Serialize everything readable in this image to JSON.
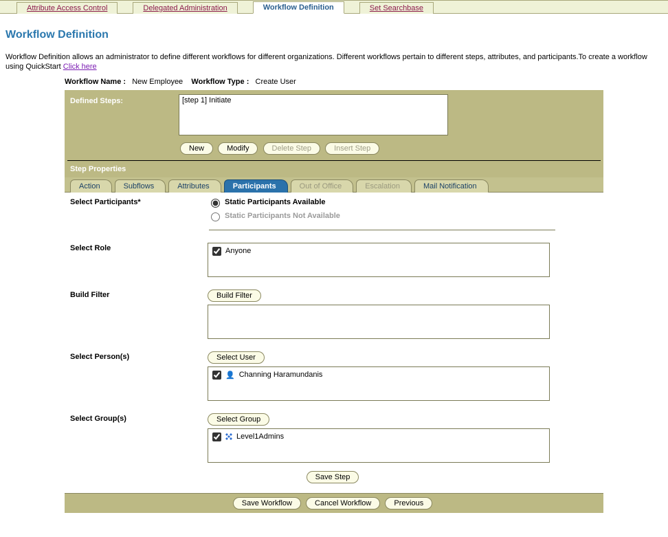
{
  "topnav": {
    "attr_access": "Attribute Access Control",
    "delegated": "Delegated Administration",
    "workflow_def": "Workflow Definition",
    "set_searchbase": "Set Searchbase"
  },
  "title": "Workflow Definition",
  "intro": {
    "text1": "Workflow Definition allows an administrator to define different workflows for different organizations. Different workflows pertain to different steps, attributes, and participants.To create a workflow using QuickStart ",
    "link": "Click here"
  },
  "meta": {
    "name_label": "Workflow Name  :",
    "name_value": "New Employee",
    "type_label": "Workflow Type  :",
    "type_value": "Create User"
  },
  "defined_steps": {
    "label": "Defined Steps:",
    "items": [
      "[step 1] Initiate"
    ]
  },
  "buttons": {
    "new": "New",
    "modify": "Modify",
    "delete_step": "Delete Step",
    "insert_step": "Insert Step",
    "build_filter": "Build Filter",
    "select_user": "Select User",
    "select_group": "Select Group",
    "save_step": "Save Step",
    "save_workflow": "Save Workflow",
    "cancel_workflow": "Cancel Workflow",
    "previous": "Previous"
  },
  "step_props": "Step Properties",
  "subtabs": {
    "action": "Action",
    "subflows": "Subflows",
    "attributes": "Attributes",
    "participants": "Participants",
    "out_of_office": "Out of Office",
    "escalation": "Escalation",
    "mail_notification": "Mail Notification"
  },
  "labels": {
    "select_participants": "Select Participants*",
    "select_role": "Select Role",
    "build_filter": "Build Filter",
    "select_persons": "Select Person(s)",
    "select_groups": "Select Group(s)"
  },
  "participants": {
    "radio_available": "Static Participants Available",
    "radio_not_available": "Static Participants Not Available"
  },
  "roles": {
    "anyone": "Anyone"
  },
  "persons": {
    "p1": "Channing Haramundanis"
  },
  "groups": {
    "g1": "Level1Admins"
  }
}
